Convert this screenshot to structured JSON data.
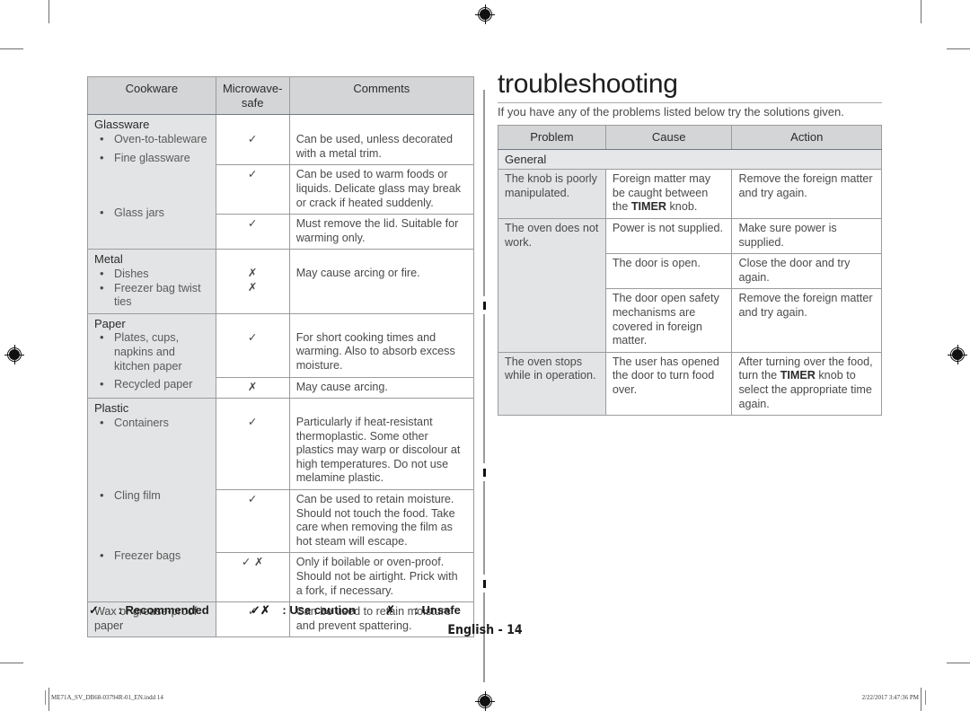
{
  "page": {
    "number_label": "English - 14",
    "print_filename": "ME71A_SV_DB68-03794R-01_EN.indd   14",
    "print_timestamp": "2/22/2017   3:47:36 PM"
  },
  "cookware_table": {
    "headers": [
      "Cookware",
      "Microwave-safe",
      "Comments"
    ],
    "groups": [
      {
        "name": "Glassware",
        "rows": [
          {
            "items": [
              "Oven-to-tableware"
            ],
            "mark": "✓",
            "comment": "Can be used, unless decorated with a metal trim."
          },
          {
            "items": [
              "Fine glassware"
            ],
            "mark": "✓",
            "comment": "Can be used to warm foods or liquids. Delicate glass may break or crack if heated suddenly."
          },
          {
            "items": [
              "Glass jars"
            ],
            "mark": "✓",
            "comment": "Must remove the lid. Suitable for warming only."
          }
        ]
      },
      {
        "name": "Metal",
        "rows": [
          {
            "items": [
              "Dishes",
              "Freezer bag twist ties"
            ],
            "mark": "✗",
            "mark2": "✗",
            "comment": "May cause arcing or fire."
          }
        ]
      },
      {
        "name": "Paper",
        "rows": [
          {
            "items": [
              "Plates, cups, napkins and kitchen paper"
            ],
            "mark": "✓",
            "comment": "For short cooking times and warming. Also to absorb excess moisture."
          },
          {
            "items": [
              "Recycled paper"
            ],
            "mark": "✗",
            "comment": "May cause arcing."
          }
        ]
      },
      {
        "name": "Plastic",
        "rows": [
          {
            "items": [
              "Containers"
            ],
            "mark": "✓",
            "comment": "Particularly if heat-resistant thermoplastic. Some other plastics may warp or discolour at high temperatures. Do not use melamine plastic."
          },
          {
            "items": [
              "Cling film"
            ],
            "mark": "✓",
            "comment": "Can be used to retain moisture. Should not touch the food. Take care when removing the film as hot steam will escape."
          },
          {
            "items": [
              "Freezer bags"
            ],
            "mark": "✓ ✗",
            "comment": "Only if boilable or oven-proof. Should not be airtight. Prick with a fork, if necessary."
          }
        ]
      }
    ],
    "final_row": {
      "label": "Wax or grease-proof paper",
      "mark": "✓",
      "comment": "Can be used to retain moisture and prevent spattering."
    }
  },
  "legend": [
    {
      "symbol": "✓",
      "label": ": Recommended"
    },
    {
      "symbol": "✓✗",
      "label": ": Use caution"
    },
    {
      "symbol": "✗",
      "label": ": Unsafe"
    }
  ],
  "troubleshooting": {
    "title": "troubleshooting",
    "intro": "If you have any of the problems listed below try the solutions given.",
    "headers": [
      "Problem",
      "Cause",
      "Action"
    ],
    "section_label": "General",
    "rows": [
      {
        "problem": "The knob is poorly manipulated.",
        "entries": [
          {
            "cause_pre": "Foreign matter may be caught between the ",
            "cause_bold": "TIMER",
            "cause_post": " knob.",
            "action_pre": "Remove the foreign matter and try again.",
            "action_bold": "",
            "action_post": ""
          }
        ]
      },
      {
        "problem": "The oven does not work.",
        "entries": [
          {
            "cause_pre": "Power is not supplied.",
            "cause_bold": "",
            "cause_post": "",
            "action_pre": "Make sure power is supplied.",
            "action_bold": "",
            "action_post": ""
          },
          {
            "cause_pre": "The door is open.",
            "cause_bold": "",
            "cause_post": "",
            "action_pre": "Close the door and try again.",
            "action_bold": "",
            "action_post": ""
          },
          {
            "cause_pre": "The door open safety mechanisms are covered in foreign matter.",
            "cause_bold": "",
            "cause_post": "",
            "action_pre": "Remove the foreign matter and try again.",
            "action_bold": "",
            "action_post": ""
          }
        ]
      },
      {
        "problem": "The oven stops while in operation.",
        "entries": [
          {
            "cause_pre": "The user has opened the door to turn food over.",
            "cause_bold": "",
            "cause_post": "",
            "action_pre": "After turning over the food, turn the ",
            "action_bold": "TIMER",
            "action_post": " knob to select the appropriate time again."
          }
        ]
      }
    ]
  }
}
